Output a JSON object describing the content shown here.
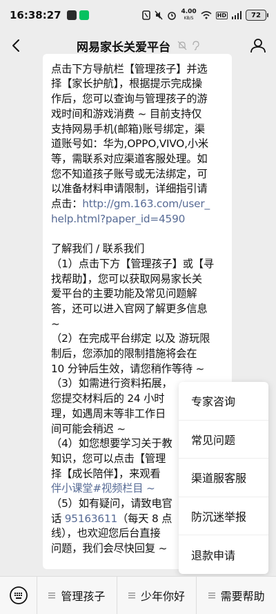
{
  "status_bar": {
    "time": "16:38:27",
    "net_speed": "4.00",
    "net_unit": "KB/S",
    "hd_label": "HD",
    "battery": "72"
  },
  "nav": {
    "title": "网易家长关爱平台"
  },
  "message": {
    "lines_top": [
      "点击下方导航栏【管理孩子】并选",
      "择【家长护航】，根据提示完成操",
      "作后，您可以查询与管理孩子的游",
      "戏时间和游戏消费 ~ 目前支持仅",
      "支持网易手机(邮箱)账号绑定，渠",
      "道账号如：华为,OPPO,VIVO,小米",
      "等，需联系对应渠道客服处理。如",
      "您不知道孩子账号或无法绑定，可",
      "以准备材料申请限制，详细指引请"
    ],
    "link_prefix": "点击：",
    "link_line1": "http://gm.163.com/user_",
    "link_line2": "help.html?paper_id=4590",
    "section_title": "了解我们 / 联系我们",
    "lines_about": [
      "（1）点击下方【管理孩子】或【寻",
      "找帮助】，您可以获取网易家长关",
      "爱平台的主要功能及常见问题解",
      "答，还可以进入官网了解更多信息",
      "~",
      "（2）在完成平台绑定 以及 游玩限",
      "制后，您添加的限制措施将会在",
      "10 分钟后生效，请您稍作等待 ~",
      "（3）如需进行资料拓展，",
      "您提交材料后的 24 小时",
      "理，如遇周末等非工作日",
      "间可能会稍迟 ~",
      "（4）如您想要学习关于教",
      "知识，您可以点击【管理",
      "择【成长陪伴】，来观看"
    ],
    "link_tail": "伴小课堂#视频栏目 ~",
    "lines_bottom_1": "（5）如有疑问，请致电官",
    "phone_prefix": "话 ",
    "phone": "95163611",
    "phone_suffix": "（每天 8 点",
    "lines_bottom_2": "线），也欢迎您后台直接",
    "lines_bottom_3": "问题，我们会尽快回复 ~"
  },
  "popup_menu": {
    "items": [
      "专家咨询",
      "常见问题",
      "渠道服客服",
      "防沉迷举报",
      "退款申请"
    ]
  },
  "tab_bar": {
    "tabs": [
      "管理孩子",
      "少年你好",
      "需要帮助"
    ]
  },
  "colors": {
    "link": "#576b95",
    "background": "#ededed",
    "bubble": "#ffffff"
  }
}
